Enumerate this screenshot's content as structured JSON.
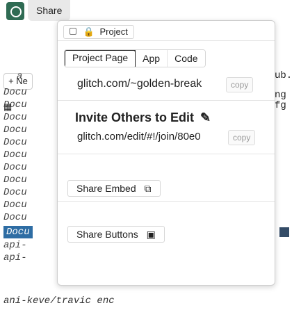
{
  "header": {
    "share_label": "Share"
  },
  "sidebar": {
    "new_label": "+ Ne",
    "folder_label": "a",
    "files": [
      "Docu",
      "Docu",
      "Docu",
      "Docu",
      "Docu",
      "Docu",
      "Docu",
      "Docu",
      "Docu",
      "Docu",
      "Docu"
    ],
    "selected_file": "Docu",
    "api_rows": [
      "api-",
      "api-"
    ],
    "bottom_text": "ani-keve/travic enc"
  },
  "background_right": {
    "text1": "ub.",
    "text2": "ng",
    "text3": "fg"
  },
  "popover": {
    "project_label": "Project",
    "tabs": [
      {
        "label": "Project Page",
        "active": true
      },
      {
        "label": "App",
        "active": false
      },
      {
        "label": "Code",
        "active": false
      }
    ],
    "project_link": "glitch.com/~golden-break",
    "copy_label": "copy",
    "invite_title": "Invite Others to Edit",
    "invite_link": "glitch.com/edit/#!/join/80e0",
    "copy_label_2": "copy",
    "share_embed_label": "Share Embed",
    "share_buttons_label": "Share Buttons"
  },
  "icons": {
    "lock_icon": "lock-icon",
    "pencil_icon": "pencil-icon",
    "embed_icon": "embed-icon",
    "buttons_icon": "buttons-icon"
  },
  "colors": {
    "logo": "#2f6b53",
    "selected_file_bg": "#2e6da4"
  }
}
